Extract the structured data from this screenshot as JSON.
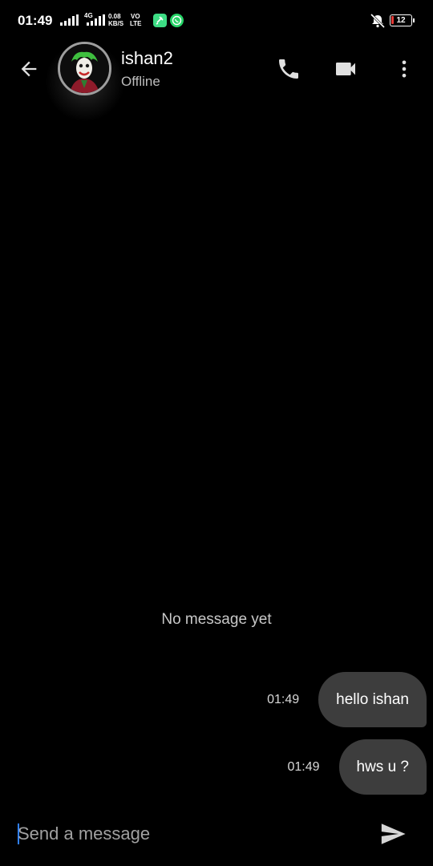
{
  "status_bar": {
    "time": "01:49",
    "network_type": "4G",
    "speed_value": "0.08",
    "speed_unit": "KB/S",
    "volte_top": "VO",
    "volte_bottom": "LTE",
    "battery_level": "12",
    "icons": [
      "signal-icon",
      "signal-4g-icon",
      "app-notification-icon",
      "whatsapp-icon",
      "mute-icon",
      "battery-icon"
    ]
  },
  "header": {
    "contact_name": "ishan2",
    "contact_status": "Offline",
    "icons": [
      "back-arrow-icon",
      "phone-icon",
      "video-camera-icon",
      "more-vert-icon"
    ]
  },
  "chat": {
    "empty_text": "No message yet",
    "messages": [
      {
        "time": "01:49",
        "text": "hello ishan"
      },
      {
        "time": "01:49",
        "text": "hws u ?"
      }
    ]
  },
  "composer": {
    "placeholder": "Send a message",
    "value": "",
    "send_icon": "send-icon"
  },
  "colors": {
    "background": "#000000",
    "bubble": "#3d3d3d",
    "caret": "#2f80ff",
    "battery_low": "#e53935",
    "whatsapp": "#25d366"
  }
}
